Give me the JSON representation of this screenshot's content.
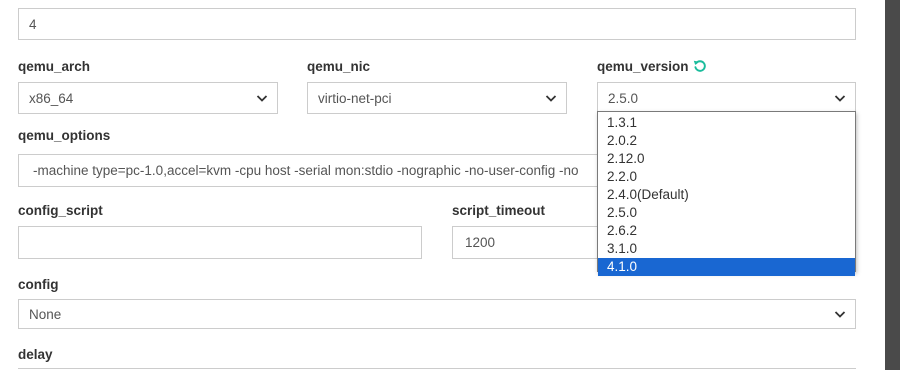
{
  "top_field": {
    "value": "4"
  },
  "qemu_arch": {
    "label": "qemu_arch",
    "value": "x86_64"
  },
  "qemu_nic": {
    "label": "qemu_nic",
    "value": "virtio-net-pci"
  },
  "qemu_version": {
    "label": "qemu_version",
    "value": "2.5.0",
    "refresh_icon": "refresh-icon",
    "refresh_color": "#1abc9c",
    "options": [
      "1.3.1",
      "2.0.2",
      "2.12.0",
      "2.2.0",
      "2.4.0(Default)",
      "2.5.0",
      "2.6.2",
      "3.1.0",
      "4.1.0"
    ],
    "highlighted_option": "4.1.0"
  },
  "qemu_options": {
    "label": "qemu_options",
    "value": "-machine type=pc-1.0,accel=kvm -cpu host -serial mon:stdio -nographic -no-user-config -no"
  },
  "config_script": {
    "label": "config_script",
    "value": ""
  },
  "script_timeout": {
    "label": "script_timeout",
    "value": "1200"
  },
  "config": {
    "label": "config",
    "value": "None"
  },
  "delay": {
    "label": "delay"
  },
  "colors": {
    "selection": "#1967d2",
    "border": "#cccccc",
    "scrollbar": "#4a4a4a"
  }
}
